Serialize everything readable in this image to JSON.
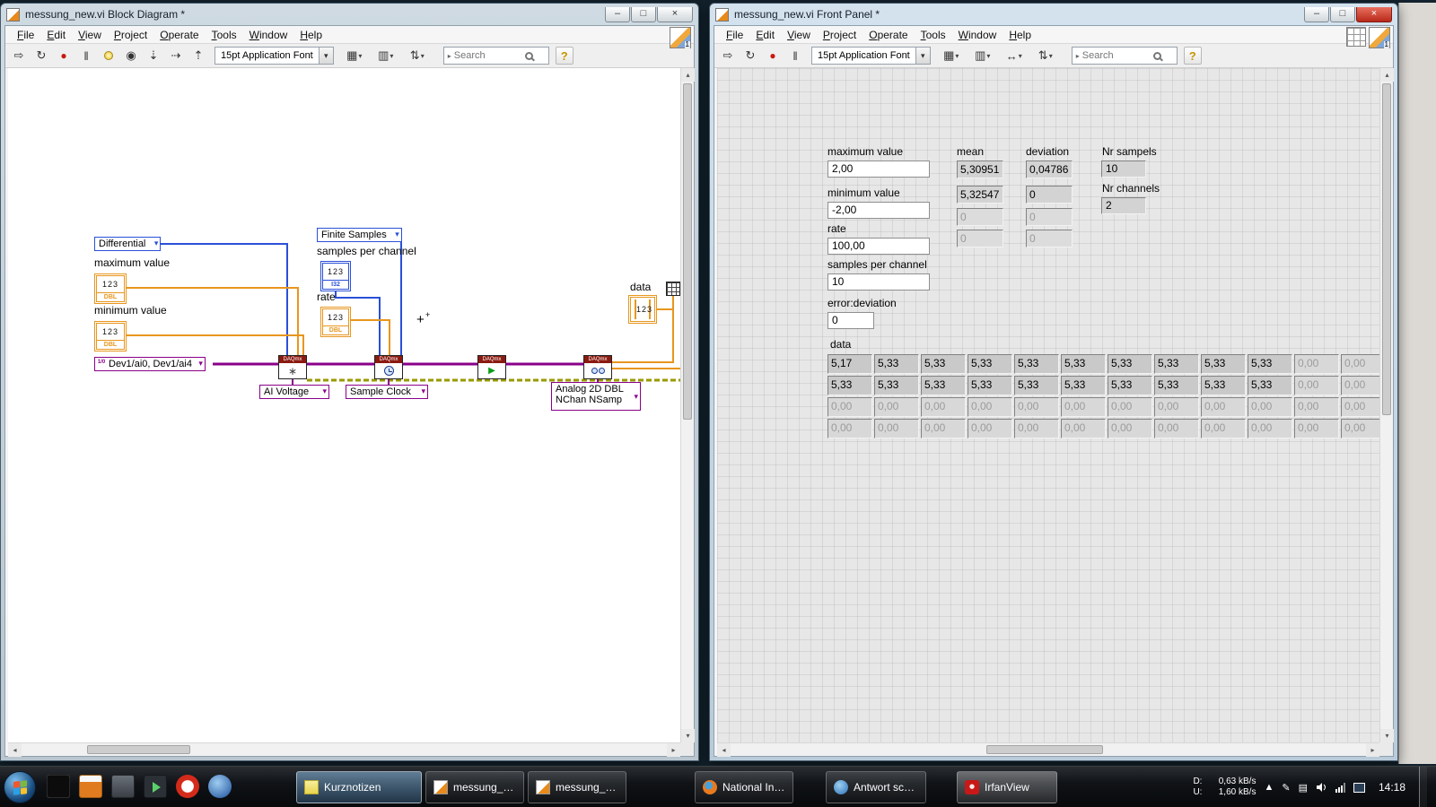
{
  "menu": [
    "File",
    "Edit",
    "View",
    "Project",
    "Operate",
    "Tools",
    "Window",
    "Help"
  ],
  "toolbar": {
    "font_selector": "15pt Application Font",
    "search_placeholder": "Search"
  },
  "icons": {
    "minimize": "–",
    "maximize": "□",
    "close": "×",
    "run": "⇨",
    "run_continuous": "↻",
    "abort": "●",
    "pause": "‖",
    "retain": "◉",
    "step_into": "⇣",
    "step_over": "⇢",
    "step_out": "⇡",
    "dropdown": "▾",
    "search_expand": "▸",
    "help": "?",
    "align": "▦",
    "distribute": "▥",
    "resize": "↔",
    "reorder": "⇅",
    "create_channel": "∗",
    "start": "▶",
    "hidden_icons": "▲",
    "pen": "✎",
    "tablet": "▤",
    "scroll_up": "▴",
    "scroll_down": "▾",
    "scroll_left": "◂",
    "scroll_right": "▸",
    "cursor_plus": "+"
  },
  "colors": {
    "wire_dbl": "#e8961e",
    "wire_int": "#2a50d8",
    "wire_task": "#8a008a",
    "wire_error": "#9a9a00",
    "node_header": "#8b1a10",
    "enum_border": "#2a50d8",
    "selector_border": "#8a008a"
  },
  "block_diagram_window": {
    "title": "messung_new.vi Block Diagram *",
    "corner_badge": "1",
    "diagram": {
      "differential": "Differential",
      "finite_samples": "Finite Samples",
      "maximum_label": "maximum value",
      "minimum_label": "minimum value",
      "samples_label": "samples per channel",
      "rate_label": "rate",
      "data_label": "data",
      "device_constant": "Dev1/ai0, Dev1/ai4",
      "daqmx": "DAQmx",
      "numeric_glyph": "123",
      "dbl": "DBL",
      "i32": "I32",
      "ai_voltage": "AI Voltage",
      "sample_clock": "Sample Clock",
      "read_mode_line1": "Analog 2D DBL",
      "read_mode_line2": "NChan NSamp"
    }
  },
  "front_panel_window": {
    "title": "messung_new.vi Front Panel *",
    "corner_badge": "1",
    "panel": {
      "maximum": {
        "label": "maximum value",
        "value": "2,00"
      },
      "minimum": {
        "label": "minimum value",
        "value": "-2,00"
      },
      "rate": {
        "label": "rate",
        "value": "100,00"
      },
      "samples": {
        "label": "samples per channel",
        "value": "10"
      },
      "error_deviation": {
        "label": "error:deviation",
        "value": "0"
      },
      "mean": {
        "label": "mean",
        "values": [
          "5,30951",
          "5,32547",
          "0",
          "0"
        ],
        "defined_count": 2
      },
      "deviation": {
        "label": "deviation",
        "values": [
          "0,04786",
          "0",
          "0",
          "0"
        ],
        "defined_count": 2
      },
      "nr_samples": {
        "label": "Nr sampels",
        "value": "10"
      },
      "nr_channels": {
        "label": "Nr channels",
        "value": "2"
      },
      "data": {
        "label": "data",
        "defined_rows": 2,
        "defined_cols": 10,
        "rows": [
          [
            "5,17",
            "5,33",
            "5,33",
            "5,33",
            "5,33",
            "5,33",
            "5,33",
            "5,33",
            "5,33",
            "5,33",
            "0,00",
            "0,00"
          ],
          [
            "5,33",
            "5,33",
            "5,33",
            "5,33",
            "5,33",
            "5,33",
            "5,33",
            "5,33",
            "5,33",
            "5,33",
            "0,00",
            "0,00"
          ],
          [
            "0,00",
            "0,00",
            "0,00",
            "0,00",
            "0,00",
            "0,00",
            "0,00",
            "0,00",
            "0,00",
            "0,00",
            "0,00",
            "0,00"
          ],
          [
            "0,00",
            "0,00",
            "0,00",
            "0,00",
            "0,00",
            "0,00",
            "0,00",
            "0,00",
            "0,00",
            "0,00",
            "0,00",
            "0,00"
          ]
        ]
      }
    }
  },
  "taskbar": {
    "buttons": [
      {
        "id": "kurznotizen",
        "icon": "sticky-note-icon",
        "label": "Kurznotizen",
        "state": "active"
      },
      {
        "id": "frontpanel",
        "icon": "labview-icon",
        "label": "messung_new.vi Fr..."
      },
      {
        "id": "blockdiagram",
        "icon": "labview-icon",
        "label": "messung_new.vi Bl..."
      },
      {
        "id": "firefox",
        "icon": "firefox-icon",
        "label": "National Instrume..."
      },
      {
        "id": "mail",
        "icon": "mail-icon",
        "label": "Antwort schreiben ..."
      },
      {
        "id": "irfanview",
        "icon": "irfanview-icon",
        "label": "IrfanView",
        "state": "highlight"
      }
    ],
    "tray": {
      "down_label": "D:",
      "down_value": "0,63 kB/s",
      "up_label": "U:",
      "up_value": "1,60 kB/s",
      "time": "14:18"
    }
  }
}
